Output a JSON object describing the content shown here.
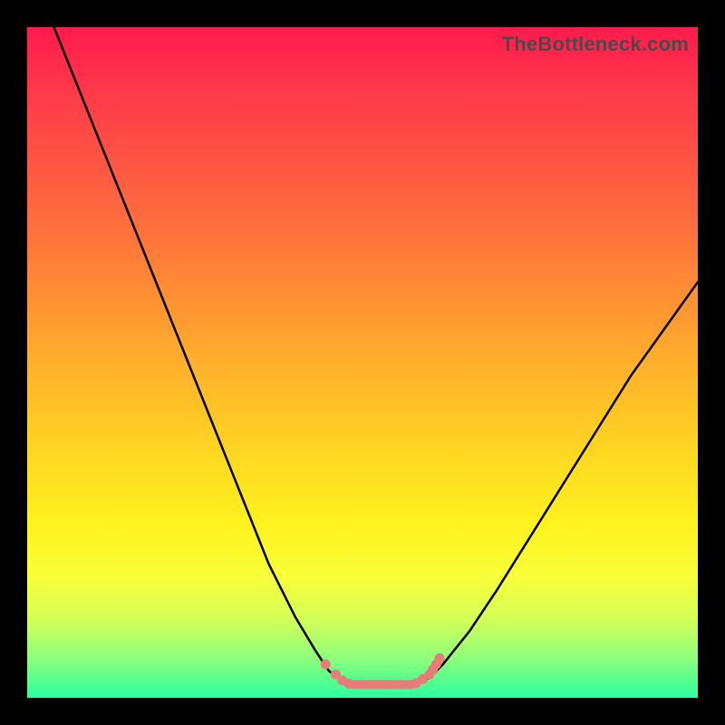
{
  "watermark": {
    "text": "TheBottleneck.com"
  },
  "chart_data": {
    "type": "line",
    "title": "",
    "xlabel": "",
    "ylabel": "",
    "xlim": [
      0,
      100
    ],
    "ylim": [
      0,
      100
    ],
    "series": [
      {
        "name": "left-curve",
        "x": [
          4,
          8,
          12,
          16,
          20,
          24,
          28,
          32,
          36,
          40,
          43,
          45,
          47,
          48
        ],
        "values": [
          100,
          90,
          80,
          70,
          60,
          50,
          40,
          30,
          20,
          12,
          7,
          4,
          2.5,
          2
        ]
      },
      {
        "name": "right-curve",
        "x": [
          58,
          60,
          62,
          66,
          70,
          75,
          80,
          85,
          90,
          95,
          100
        ],
        "values": [
          2,
          3,
          5,
          10,
          16,
          24,
          32,
          40,
          48,
          55,
          62
        ]
      }
    ],
    "flat_segment": {
      "x0": 48,
      "x1": 58,
      "y": 2
    },
    "markers": {
      "left_cluster": [
        [
          44.5,
          5.0
        ],
        [
          46.0,
          3.5
        ],
        [
          47.0,
          2.6
        ],
        [
          48.0,
          2.1
        ],
        [
          49.0,
          2.0
        ],
        [
          50.0,
          2.0
        ],
        [
          51.0,
          2.0
        ],
        [
          52.0,
          2.0
        ],
        [
          53.0,
          2.0
        ],
        [
          54.0,
          2.0
        ],
        [
          55.0,
          2.0
        ]
      ],
      "right_cluster": [
        [
          56.0,
          2.0
        ],
        [
          57.0,
          2.0
        ],
        [
          58.0,
          2.2
        ],
        [
          59.0,
          2.8
        ],
        [
          60.0,
          3.5
        ],
        [
          60.5,
          4.2
        ],
        [
          61.0,
          5.0
        ],
        [
          61.5,
          5.9
        ]
      ]
    },
    "marker_color": "#e77c78",
    "curve_color": "#000000",
    "gradient_stops": [
      {
        "pct": 0,
        "color": "#ff1a4d"
      },
      {
        "pct": 28,
        "color": "#ff6a3e"
      },
      {
        "pct": 52,
        "color": "#ffb52a"
      },
      {
        "pct": 74,
        "color": "#fff21e"
      },
      {
        "pct": 94,
        "color": "#8fff7a"
      },
      {
        "pct": 100,
        "color": "#2aff9f"
      }
    ]
  }
}
